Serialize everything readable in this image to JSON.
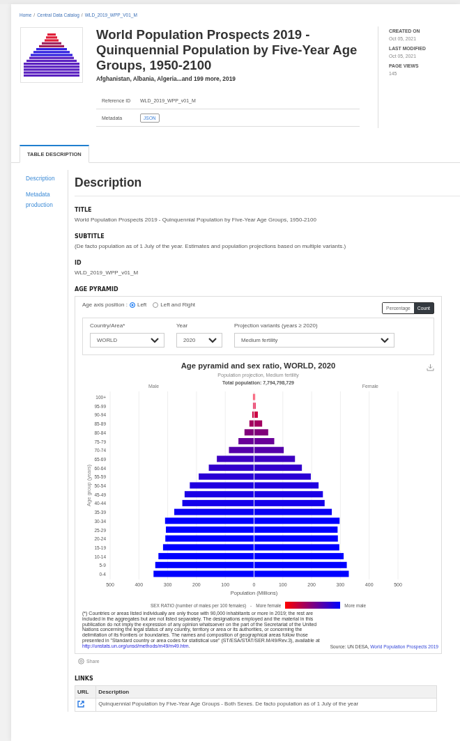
{
  "breadcrumb": {
    "separator": "/",
    "items": [
      {
        "label": "Home"
      },
      {
        "label": "Central Data Catalog"
      },
      {
        "label": "WLD_2019_WPP_V01_M"
      }
    ]
  },
  "header": {
    "title": "World Population Prospects 2019 - Quinquennial Population by Five-Year Age Groups, 1950-2100",
    "subtitle": "Afghanistan, Albania, Algeria...and 199 more, 2019",
    "fields": [
      {
        "label": "Reference ID",
        "value": "WLD_2019_WPP_v01_M",
        "kind": "text"
      },
      {
        "label": "Metadata",
        "value": "JSON",
        "kind": "button"
      }
    ]
  },
  "meta": [
    {
      "label": "CREATED ON",
      "value": "Oct 05, 2021"
    },
    {
      "label": "LAST MODIFIED",
      "value": "Oct 05, 2021"
    },
    {
      "label": "PAGE VIEWS",
      "value": "145"
    }
  ],
  "tabs": [
    {
      "label": "TABLE DESCRIPTION",
      "selected": true
    }
  ],
  "sidebar": {
    "items": [
      {
        "label": "Description"
      },
      {
        "label": "Metadata production"
      }
    ]
  },
  "content": {
    "heading": "Description",
    "sections": [
      {
        "label": "TITLE",
        "value": "World Population Prospects 2019 - Quinquennial Population by Five-Year Age Groups, 1950-2100"
      },
      {
        "label": "SUBTITLE",
        "value": "(De facto population as of 1 July of the year. Estimates and population projections based on multiple variants.)"
      },
      {
        "label": "ID",
        "value": "WLD_2019_WPP_v01_M"
      }
    ],
    "pyramid": {
      "label": "AGE PYRAMID",
      "axis_position": {
        "label": "Age axis position :",
        "options": [
          {
            "label": "Left",
            "selected": true
          },
          {
            "label": "Left and Right",
            "selected": false
          }
        ]
      },
      "modes": [
        {
          "label": "Percentage",
          "selected": false
        },
        {
          "label": "Count",
          "selected": true
        }
      ],
      "filters": [
        {
          "label": "Country/Area*",
          "value": "WORLD"
        },
        {
          "label": "Year",
          "value": "2020"
        },
        {
          "label": "Projection variants (years ≥ 2020)",
          "value": "Medium fertility"
        }
      ],
      "chart_title": "Age pyramid and sex ratio, WORLD, 2020",
      "chart_subtitle": "Population projection, Medium fertility",
      "total": "Total population: 7,794,798,729",
      "chart_data": {
        "type": "bar",
        "orientation": "horizontal",
        "stacked": true,
        "grid": true,
        "xlabel": "Population (Millions)",
        "ylabel": "Age group (years)",
        "categories": [
          "100+",
          "95-99",
          "90-94",
          "85-89",
          "80-84",
          "75-79",
          "70-74",
          "65-69",
          "60-64",
          "55-59",
          "50-54",
          "45-49",
          "40-44",
          "35-39",
          "30-34",
          "25-29",
          "20-24",
          "15-19",
          "10-14",
          "5-9",
          "0-4"
        ],
        "series": [
          {
            "name": "Male",
            "values": [
              -1,
              -2,
              -5,
              -15,
              -32,
              -53,
              -86,
              -128,
              -156,
              -191,
              -222,
              -240,
              -248,
              -276,
              -308,
              -305,
              -307,
              -315,
              -331,
              -342,
              -348
            ],
            "colors": [
              "#ff1a40",
              "#e8003c",
              "#cc0044",
              "#a30060",
              "#80007a",
              "#6a0099",
              "#5500aa",
              "#3d00c2",
              "#3300cc",
              "#2a00d5",
              "#1f00e0",
              "#1a00e6",
              "#1400eb",
              "#0a00f5",
              "#0000ff",
              "#0000ff",
              "#0000ff",
              "#0000ff",
              "#0000ff",
              "#0000ff",
              "#0000ff"
            ]
          },
          {
            "name": "Female",
            "values": [
              1,
              4,
              12,
              27,
              48,
              69,
              102,
              141,
              165,
              196,
              223,
              238,
              244,
              269,
              296,
              289,
              290,
              295,
              310,
              321,
              328
            ],
            "colors": [
              "#ff1a40",
              "#e8003c",
              "#cc0044",
              "#a30060",
              "#80007a",
              "#6a0099",
              "#5500aa",
              "#3d00c2",
              "#3300cc",
              "#2a00d5",
              "#1f00e0",
              "#1a00e6",
              "#1400eb",
              "#0a00f5",
              "#0000ff",
              "#0000ff",
              "#0000ff",
              "#0000ff",
              "#0000ff",
              "#0000ff",
              "#0000ff"
            ]
          }
        ],
        "xlim": [
          -500,
          500
        ],
        "xticks": [
          {
            "value": -500,
            "label": "500"
          },
          {
            "value": -400,
            "label": "400"
          },
          {
            "value": -300,
            "label": "300"
          },
          {
            "value": -200,
            "label": "200"
          },
          {
            "value": -100,
            "label": "100"
          },
          {
            "value": 0,
            "label": "0"
          },
          {
            "value": 100,
            "label": "100"
          },
          {
            "value": 200,
            "label": "200"
          },
          {
            "value": 300,
            "label": "300"
          },
          {
            "value": 400,
            "label": "400"
          },
          {
            "value": 500,
            "label": "500"
          }
        ]
      },
      "legend": {
        "label": "SEX RATIO (number of males per 100 females)",
        "separator": "-",
        "low": "More female",
        "high": "More male"
      },
      "footnote": {
        "text": "(*) Countries or areas listed individually are only those with 90,000 inhabitants or more in 2019; the rest are included in the aggregates but are not listed separately. The designations employed and the material in this publication do not imply the expression of any opinion whatsoever on the part of the Secretariat of the United Nations concerning the legal status of any country, territory or area or its authorities, or concerning the delimitation of its frontiers or boundaries. The names and composition of geographical areas follow those presented in \"Standard country or area codes for statistical use\" (ST/ESA/STAT/SER.M/49/Rev.3), available at",
        "link": "http://unstats.un.org/unsd/methods/m49/m49.htm",
        "end": "."
      },
      "source": {
        "label": "Source: UN DESA,",
        "link": "World Population Prospects 2019"
      },
      "share": "Share"
    }
  },
  "links": {
    "label": "LINKS",
    "columns": [
      "URL",
      "Description"
    ],
    "rows": [
      {
        "description": "Quinquennial Population by Five-Year Age Groups - Both Sexes. De facto population as of 1 July of the year"
      }
    ]
  }
}
